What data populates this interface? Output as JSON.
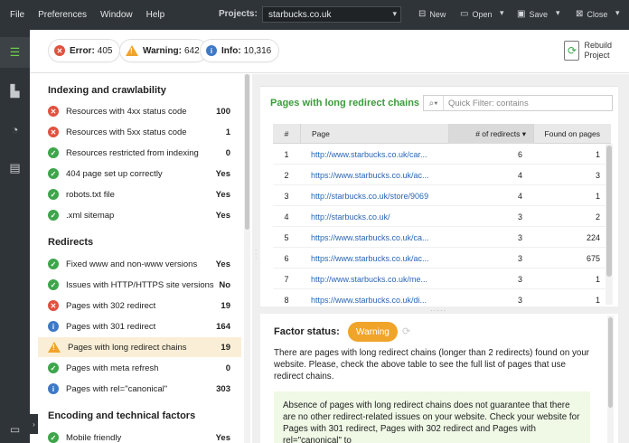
{
  "menu": [
    "File",
    "Preferences",
    "Window",
    "Help"
  ],
  "projects": {
    "label": "Projects:",
    "value": "starbucks.co.uk"
  },
  "toolbar": {
    "new": "New",
    "open": "Open",
    "save": "Save",
    "close": "Close"
  },
  "status": {
    "error_label": "Error:",
    "error_count": "405",
    "warning_label": "Warning:",
    "warning_count": "642",
    "info_label": "Info:",
    "info_count": "10,316"
  },
  "rebuild": {
    "line1": "Rebuild",
    "line2": "Project"
  },
  "sections": [
    {
      "title": "Indexing and crawlability",
      "items": [
        {
          "status": "error",
          "label": "Resources with 4xx status code",
          "value": "100"
        },
        {
          "status": "error",
          "label": "Resources with 5xx status code",
          "value": "1"
        },
        {
          "status": "ok",
          "label": "Resources restricted from indexing",
          "value": "0"
        },
        {
          "status": "ok",
          "label": "404 page set up correctly",
          "value": "Yes"
        },
        {
          "status": "ok",
          "label": "robots.txt file",
          "value": "Yes"
        },
        {
          "status": "ok",
          "label": ".xml sitemap",
          "value": "Yes"
        }
      ]
    },
    {
      "title": "Redirects",
      "items": [
        {
          "status": "ok",
          "label": "Fixed www and non-www versions",
          "value": "Yes"
        },
        {
          "status": "ok",
          "label": "Issues with HTTP/HTTPS site versions",
          "value": "No"
        },
        {
          "status": "error",
          "label": "Pages with 302 redirect",
          "value": "19"
        },
        {
          "status": "info",
          "label": "Pages with 301 redirect",
          "value": "164"
        },
        {
          "status": "warning",
          "label": "Pages with long redirect chains",
          "value": "19"
        },
        {
          "status": "ok",
          "label": "Pages with meta refresh",
          "value": "0"
        },
        {
          "status": "info",
          "label": "Pages with rel=\"canonical\"",
          "value": "303"
        }
      ]
    },
    {
      "title": "Encoding and technical factors",
      "items": [
        {
          "status": "ok",
          "label": "Mobile friendly",
          "value": "Yes"
        }
      ]
    }
  ],
  "table": {
    "title": "Pages with long redirect chains",
    "filter_placeholder": "Quick Filter: contains",
    "headers": {
      "num": "#",
      "page": "Page",
      "redirects": "# of redirects",
      "found": "Found on pages"
    },
    "rows": [
      {
        "n": "1",
        "page": "http://www.starbucks.co.uk/car...",
        "redirects": "6",
        "found": "1"
      },
      {
        "n": "2",
        "page": "https://www.starbucks.co.uk/ac...",
        "redirects": "4",
        "found": "3"
      },
      {
        "n": "3",
        "page": "http://starbucks.co.uk/store/9069",
        "redirects": "4",
        "found": "1"
      },
      {
        "n": "4",
        "page": "http://starbucks.co.uk/",
        "redirects": "3",
        "found": "2"
      },
      {
        "n": "5",
        "page": "https://www.starbucks.co.uk/ca...",
        "redirects": "3",
        "found": "224"
      },
      {
        "n": "6",
        "page": "https://www.starbucks.co.uk/ac...",
        "redirects": "3",
        "found": "675"
      },
      {
        "n": "7",
        "page": "http://www.starbucks.co.uk/me...",
        "redirects": "3",
        "found": "1"
      },
      {
        "n": "8",
        "page": "https://www.starbucks.co.uk/di...",
        "redirects": "3",
        "found": "1"
      }
    ]
  },
  "factor": {
    "label": "Factor status:",
    "status": "Warning",
    "description": "There are pages with long redirect chains (longer than 2 redirects) found on your website. Please, check the above table to see the full list of pages that use redirect chains.",
    "note": "Absence of pages with long redirect chains does not guarantee that there are no other redirect-related issues on your website. Check your website for Pages with 301 redirect, Pages with 302 redirect and Pages with rel=\"canonical\" to"
  },
  "colors": {
    "error": "#e2503f",
    "ok": "#3ea54b",
    "info": "#3e79c8",
    "warning": "#f0a42a",
    "accent_green": "#3a9c3a"
  }
}
